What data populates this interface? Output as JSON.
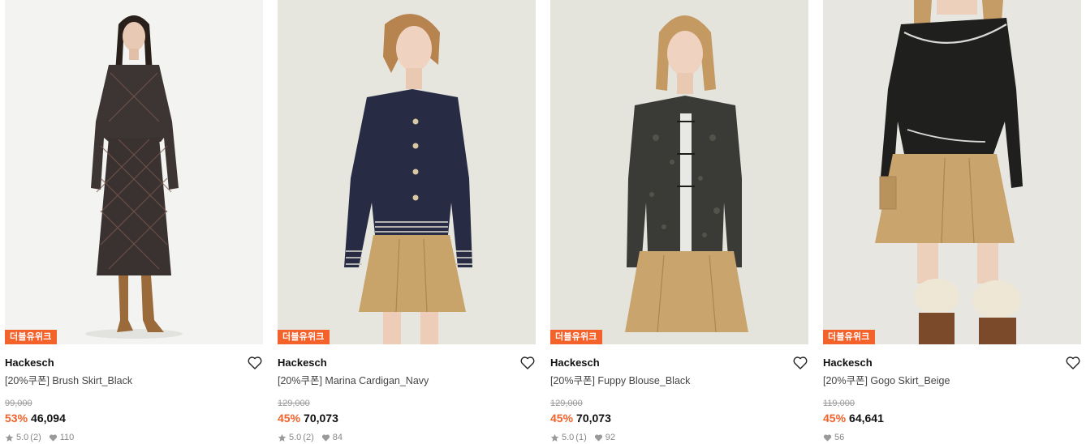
{
  "products": [
    {
      "badge": "더블유위크",
      "brand": "Hackesch",
      "name": "[20%쿠폰] Brush Skirt_Black",
      "original_price": "99,000",
      "discount": "53%",
      "price": "46,094",
      "rating": "5.0",
      "reviews": "(2)",
      "likes": "110",
      "show_rating": true
    },
    {
      "badge": "더블유위크",
      "brand": "Hackesch",
      "name": "[20%쿠폰] Marina Cardigan_Navy",
      "original_price": "129,000",
      "discount": "45%",
      "price": "70,073",
      "rating": "5.0",
      "reviews": "(2)",
      "likes": "84",
      "show_rating": true
    },
    {
      "badge": "더블유위크",
      "brand": "Hackesch",
      "name": "[20%쿠폰] Fuppy Blouse_Black",
      "original_price": "129,000",
      "discount": "45%",
      "price": "70,073",
      "rating": "5.0",
      "reviews": "(1)",
      "likes": "92",
      "show_rating": true
    },
    {
      "badge": "더블유위크",
      "brand": "Hackesch",
      "name": "[20%쿠폰] Gogo Skirt_Beige",
      "original_price": "119,000",
      "discount": "45%",
      "price": "64,641",
      "rating": "",
      "reviews": "",
      "likes": "56",
      "show_rating": false
    }
  ],
  "colors": {
    "accent": "#f3622a",
    "text": "#111111",
    "muted": "#888888"
  },
  "icons": {
    "wishlist": "heart-outline-icon",
    "rating": "star-icon",
    "likes": "heart-filled-icon"
  }
}
